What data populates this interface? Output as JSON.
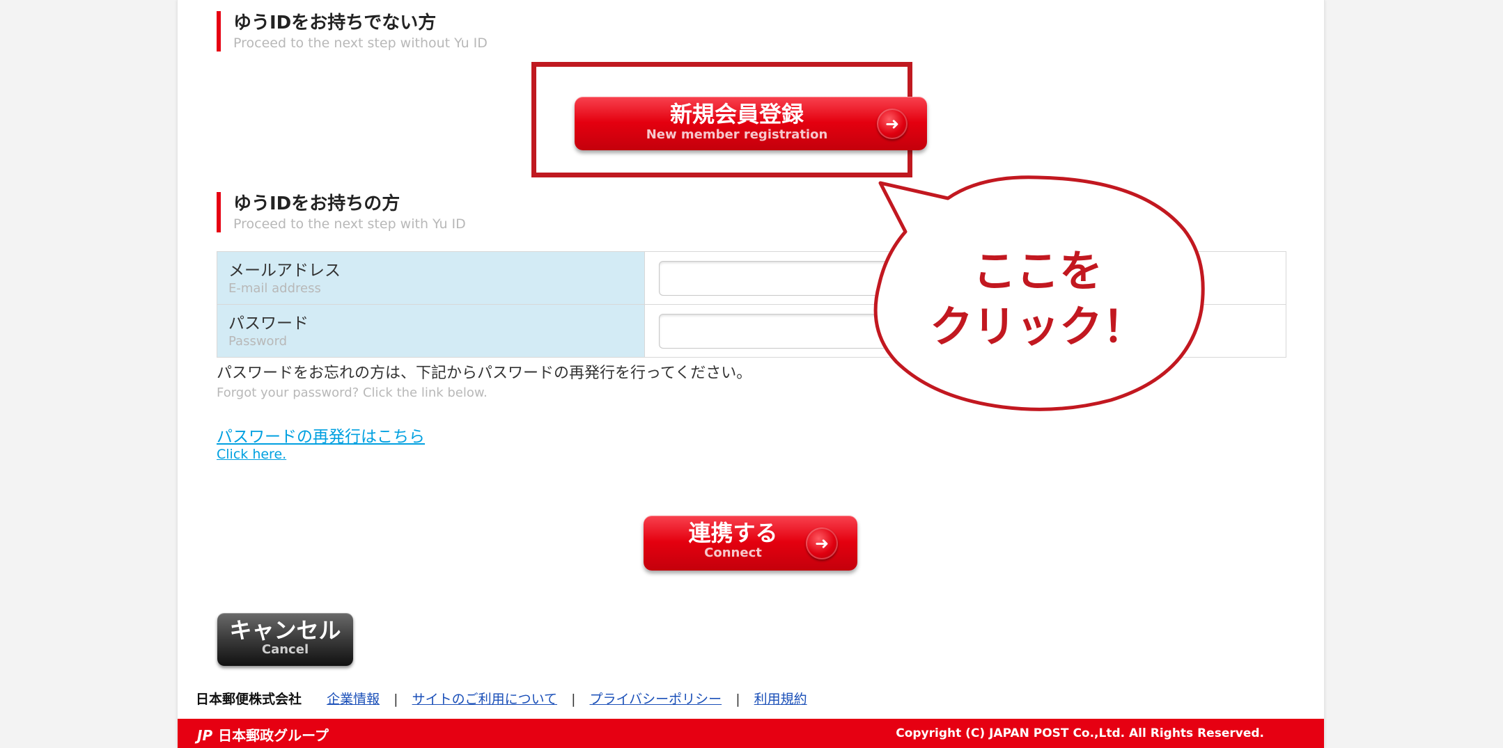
{
  "section_without_id": {
    "title": "ゆうIDをお持ちでない方",
    "subtitle": "Proceed to the next step without Yu ID"
  },
  "register_button": {
    "label": "新規会員登録",
    "sublabel": "New member registration"
  },
  "section_with_id": {
    "title": "ゆうIDをお持ちの方",
    "subtitle": "Proceed to the next step with Yu ID"
  },
  "email": {
    "label": "メールアドレス",
    "sublabel": "E-mail address",
    "value": "",
    "placeholder": ""
  },
  "password": {
    "label": "パスワード",
    "sublabel": "Password",
    "value": "",
    "placeholder": ""
  },
  "forgot": {
    "note": "パスワードをお忘れの方は、下記からパスワードの再発行を行ってください。",
    "note_en": "Forgot your password? Click the link below.",
    "link": "パスワードの再発行はこちら",
    "link_en": "Click here."
  },
  "connect_button": {
    "label": "連携する",
    "sublabel": "Connect"
  },
  "cancel_button": {
    "label": "キャンセル",
    "sublabel": "Cancel"
  },
  "footer": {
    "company": "日本郵便株式会社",
    "links": [
      "企業情報",
      "サイトのご利用について",
      "プライバシーポリシー",
      "利用規約"
    ],
    "separator": "|",
    "group_logo": "日本郵政グループ",
    "copyright": "Copyright (C) JAPAN POST Co.,Ltd.  All Rights Reserved."
  },
  "callout": {
    "line1": "ここを",
    "line2": "クリック！"
  },
  "icons": {
    "arrow": "arrow-right-icon",
    "brand": "jp-logo-icon"
  },
  "colors": {
    "brand_red": "#e60012",
    "highlight_red": "#c01920",
    "label_bg": "#d3ebf5",
    "link_blue": "#00a0e0"
  }
}
